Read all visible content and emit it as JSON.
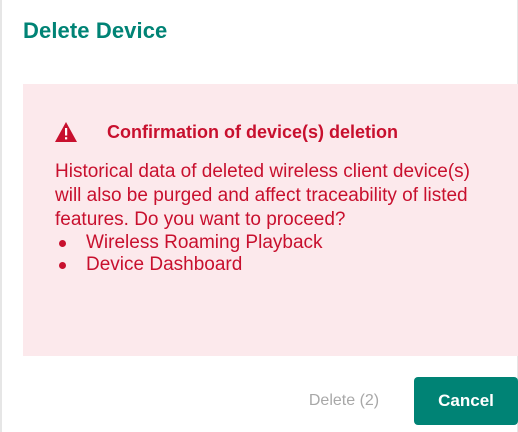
{
  "dialog": {
    "title": "Delete Device",
    "accent_color": "#008375"
  },
  "alert": {
    "icon": "warning-triangle-icon",
    "title": "Confirmation of device(s) deletion",
    "message": "Historical data of deleted wireless client device(s) will also be purged and affect traceability of listed features. Do you want to proceed?",
    "items": [
      {
        "label": "Wireless Roaming Playback"
      },
      {
        "label": "Device Dashboard"
      }
    ],
    "text_color": "#c8102e",
    "background_color": "#fce9ec"
  },
  "footer": {
    "delete_label": "Delete (2)",
    "delete_disabled": true,
    "cancel_label": "Cancel"
  }
}
